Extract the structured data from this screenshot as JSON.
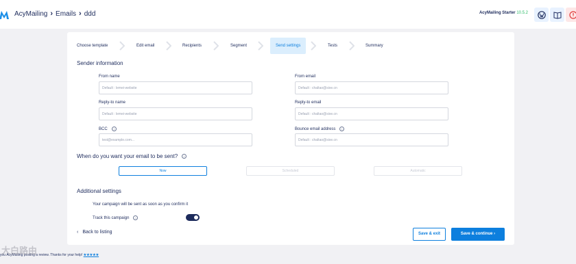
{
  "header": {
    "breadcrumb": [
      "AcyMailing",
      "Emails",
      "ddd"
    ],
    "plan_name": "AcyMailing Starter",
    "plan_version": "10.5.2"
  },
  "steps": [
    {
      "label": "Choose template"
    },
    {
      "label": "Edit email"
    },
    {
      "label": "Recipients"
    },
    {
      "label": "Segment"
    },
    {
      "label": "Send settings",
      "active": true
    },
    {
      "label": "Tests"
    },
    {
      "label": "Summary"
    }
  ],
  "sender": {
    "title": "Sender information",
    "from_name_label": "From name",
    "from_name_placeholder": "Default : lemei-website",
    "from_email_label": "From email",
    "from_email_placeholder": "Default : chaltao@sixe.cn",
    "reply_name_label": "Reply-to name",
    "reply_name_placeholder": "Default : lemei-website",
    "reply_email_label": "Reply-to email",
    "reply_email_placeholder": "Default : chaltao@sixe.cn",
    "bcc_label": "BCC",
    "bcc_placeholder": "test@example.com...",
    "bounce_label": "Bounce email address",
    "bounce_placeholder": "Default : chaltao@sixe.cn"
  },
  "sending": {
    "title": "When do you want your email to be sent?",
    "options": [
      "Now",
      "Scheduled",
      "Automatic"
    ]
  },
  "additional": {
    "title": "Additional settings",
    "confirm_text": "Your campaign will be sent as soon as you confirm it",
    "track_label": "Track this campaign",
    "track_enabled": true
  },
  "actions": {
    "back_label": "Back to listing",
    "save_exit_label": "Save & exit",
    "save_continue_label": "Save & continue"
  },
  "footer": {
    "text_start": "you",
    "text_mid": "AcyMailing",
    "text_end": "posting a review. Thanks for your help!",
    "stars": "★★★★★",
    "watermark": "大白路由"
  },
  "colors": {
    "accent": "#0d7fde",
    "navy": "#1d2b5c",
    "active_step_bg": "#dbeefd",
    "version_green": "#2dbb68"
  }
}
